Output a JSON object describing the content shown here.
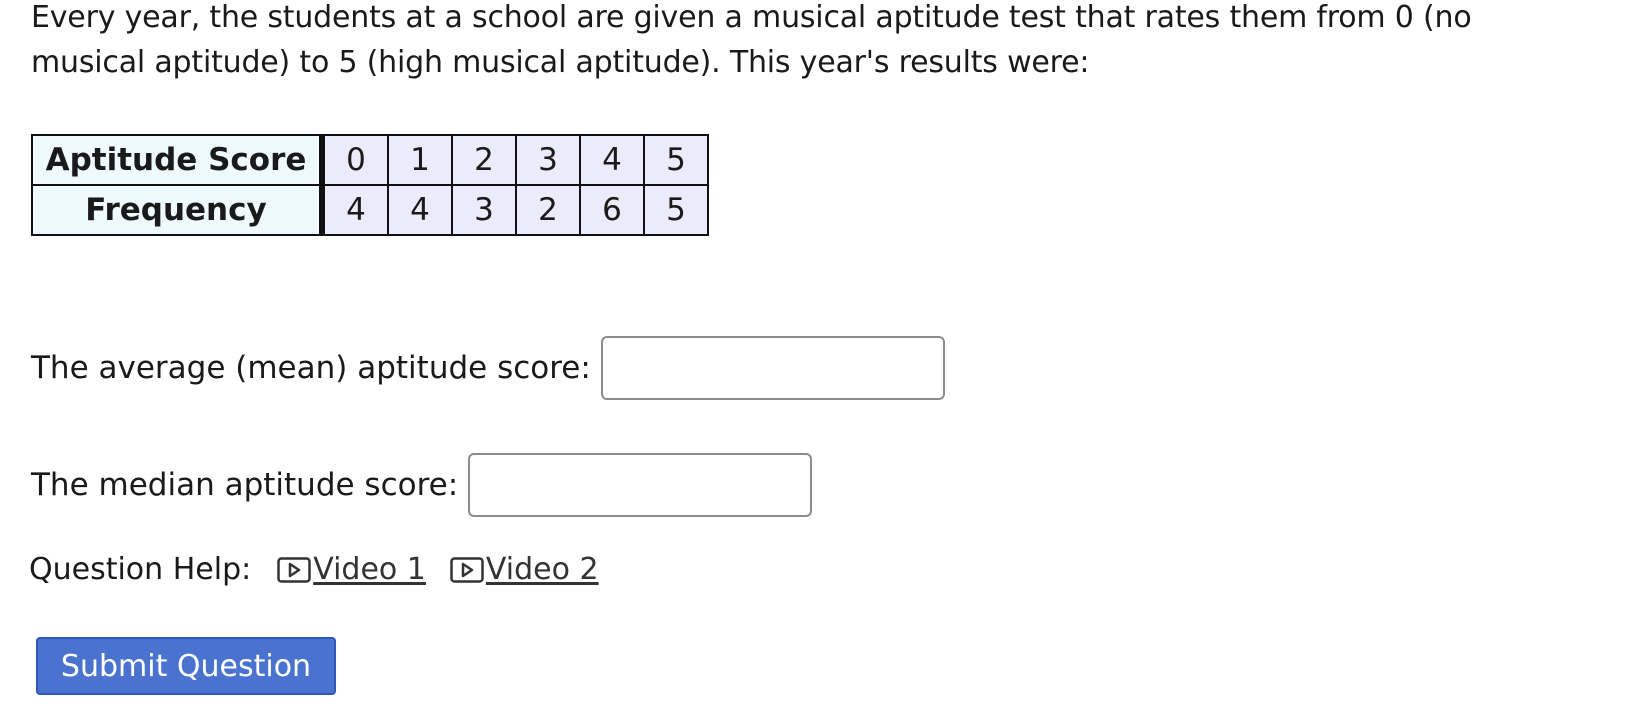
{
  "question": {
    "text": "Every year, the students at a school are given a musical aptitude test that rates them from 0 (no musical aptitude) to 5 (high musical aptitude). This year's results were:"
  },
  "table": {
    "row1_header": "Aptitude Score",
    "row2_header": "Frequency",
    "scores": [
      "0",
      "1",
      "2",
      "3",
      "4",
      "5"
    ],
    "frequencies": [
      "4",
      "4",
      "3",
      "2",
      "6",
      "5"
    ]
  },
  "answers": {
    "mean_label": "The average (mean) aptitude score:",
    "mean_value": "",
    "median_label": "The median aptitude score:",
    "median_value": ""
  },
  "help": {
    "label": "Question Help:",
    "video1_label": "Video 1",
    "video2_label": "Video 2",
    "icon": "play-icon"
  },
  "submit": {
    "label": "Submit Question",
    "color": "#4a73d0"
  }
}
